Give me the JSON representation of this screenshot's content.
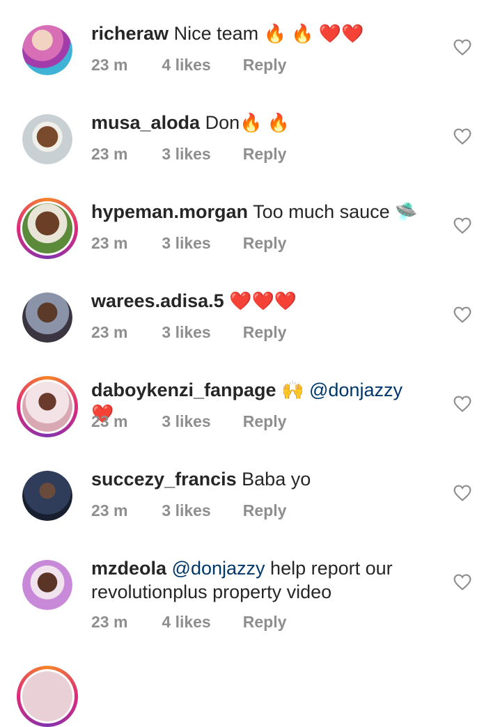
{
  "comments": [
    {
      "username": "richeraw",
      "text": "Nice team",
      "emoji": "🔥 🔥 ❤️❤️",
      "time": "23 m",
      "likes": "4 likes",
      "reply": "Reply"
    },
    {
      "username": "musa_aloda",
      "text": "Don",
      "emoji": "🔥 🔥",
      "time": "23 m",
      "likes": "3 likes",
      "reply": "Reply"
    },
    {
      "username": "hypeman.morgan",
      "text": "Too much sauce",
      "emoji": "🛸",
      "time": "23 m",
      "likes": "3 likes",
      "reply": "Reply"
    },
    {
      "username": "warees.adisa.5",
      "text": "",
      "emoji": "❤️❤️❤️",
      "time": "23 m",
      "likes": "3 likes",
      "reply": "Reply"
    },
    {
      "username": "daboykenzi_fanpage",
      "text": "🙌",
      "mention": "@donjazzy",
      "emoji": "❤️",
      "time": "23 m",
      "likes": "3 likes",
      "reply": "Reply"
    },
    {
      "username": "succezy_francis",
      "text": "Baba yo",
      "emoji": "",
      "time": "23 m",
      "likes": "3 likes",
      "reply": "Reply"
    },
    {
      "username": "mzdeola",
      "mention": "@donjazzy",
      "text": "help report our revolutionplus property video",
      "time": "23 m",
      "likes": "4 likes",
      "reply": "Reply"
    }
  ],
  "colors": {
    "mention": "#00376b",
    "meta": "#8e8e8e",
    "story_ring_start": "#f58529",
    "story_ring_end": "#dd2a7b"
  },
  "icons": {
    "like": "heart-outline-icon"
  }
}
